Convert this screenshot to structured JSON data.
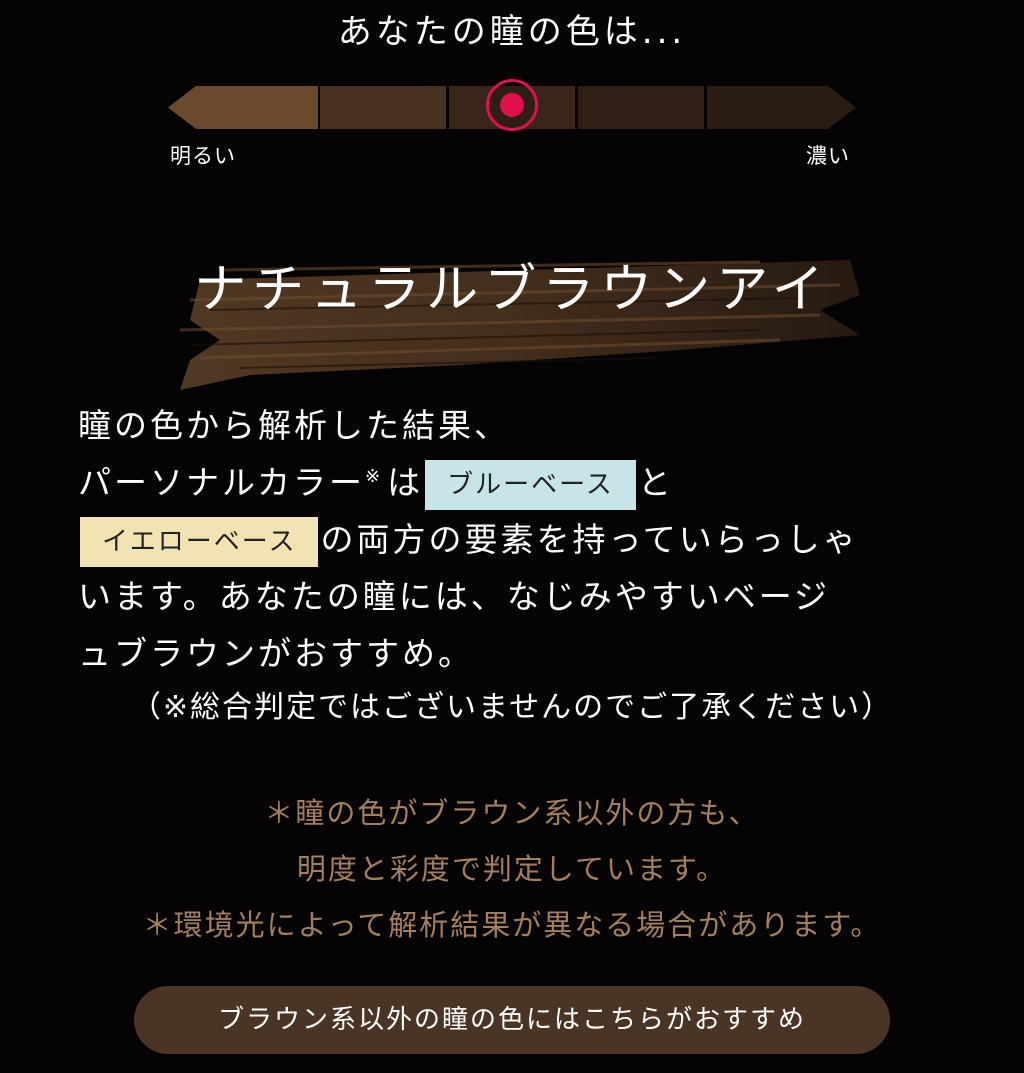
{
  "header": {
    "title": "あなたの瞳の色は..."
  },
  "scale": {
    "label_light": "明るい",
    "label_dark": "濃い",
    "segments": 5,
    "selected_index": 3,
    "marker_color": "#e0104e",
    "segment_colors": [
      "#6a4a2c",
      "#4a3020",
      "#3a2618",
      "#2f1f14",
      "#291c13"
    ]
  },
  "result": {
    "type_title": "ナチュラルブラウンアイ",
    "line1": "瞳の色から解析した結果、",
    "line2_prefix": "パーソナルカラー",
    "note_mark": "※",
    "line2_mid": "は",
    "badge_blue": "ブルーベース",
    "line2_suffix": "と",
    "badge_yellow": "イエローベース",
    "line3_suffix": "の両方の要素を持っていらっしゃ",
    "line4": "います。あなたの瞳には、なじみやすいベージ",
    "line5": "ュブラウンがおすすめ。",
    "disclaimer": "（※総合判定ではございませんのでご了承ください）"
  },
  "notes": {
    "line1": "＊瞳の色がブラウン系以外の方も、",
    "line2": "明度と彩度で判定しています。",
    "line3": "＊環境光によって解析結果が異なる場合があります。"
  },
  "cta": {
    "label": "ブラウン系以外の瞳の色にはこちらがおすすめ"
  },
  "colors": {
    "background": "#050303",
    "note_text": "#a47f5e",
    "cta_bg": "#4a3426",
    "badge_blue": "#c7e4e6",
    "badge_yellow": "#f2e4b2"
  }
}
